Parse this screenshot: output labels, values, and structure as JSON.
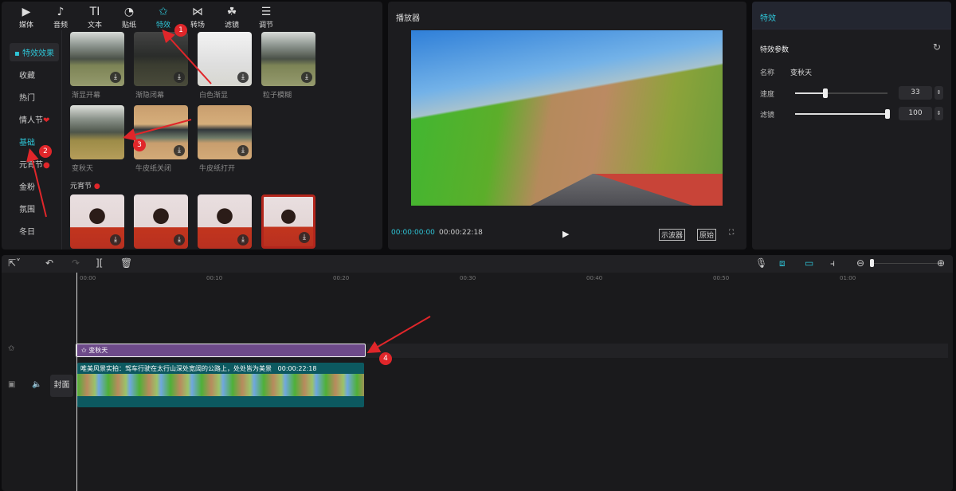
{
  "left_panel": {
    "tabs": [
      {
        "label": "媒体",
        "icon": "▶"
      },
      {
        "label": "音频",
        "icon": "♪"
      },
      {
        "label": "文本",
        "icon": "TI"
      },
      {
        "label": "贴纸",
        "icon": "◔"
      },
      {
        "label": "特效",
        "icon": "✩"
      },
      {
        "label": "转场",
        "icon": "⋈"
      },
      {
        "label": "滤镜",
        "icon": "☘"
      },
      {
        "label": "调节",
        "icon": "☰"
      }
    ],
    "active_tab": "特效",
    "sidebar": [
      "特效效果",
      "收藏",
      "热门",
      "情人节",
      "基础",
      "元宵节",
      "金粉",
      "氛围",
      "冬日"
    ],
    "effects": [
      {
        "label": "渐显开幕"
      },
      {
        "label": "渐隐闭幕"
      },
      {
        "label": "白色渐显"
      },
      {
        "label": "粒子模糊"
      },
      {
        "label": "变秋天"
      },
      {
        "label": "牛皮纸关闭"
      },
      {
        "label": "牛皮纸打开"
      }
    ],
    "section_label": "元宵节"
  },
  "player": {
    "title": "播放器",
    "current_time": "00:00:00:00",
    "total_time": "00:00:22:18",
    "scope_btn": "示波器",
    "original_btn": "原始"
  },
  "right_panel": {
    "title": "特效",
    "section": "特效参数",
    "name_label": "名称",
    "name_value": "变秋天",
    "speed_label": "速度",
    "speed_value": "33",
    "filter_label": "滤镜",
    "filter_value": "100",
    "speed_fraction": 0.33,
    "filter_fraction": 1.0
  },
  "timeline": {
    "ticks": [
      "00:00",
      "00:10",
      "00:20",
      "00:30",
      "00:40",
      "00:50",
      "01:00"
    ],
    "effect_clip": "变秋天",
    "video_caption": "唯美风景实拍：驾车行驶在太行山深处宽阔的公路上，处处皆为美景",
    "video_duration": "00:00:22:18",
    "cover_label": "封面"
  },
  "annotations": [
    "1",
    "2",
    "3",
    "4"
  ],
  "colors": {
    "accent": "#2ec4d6",
    "effect_clip": "#6d4a89",
    "video_clip": "#0c5960",
    "annotation": "#e0262a"
  }
}
